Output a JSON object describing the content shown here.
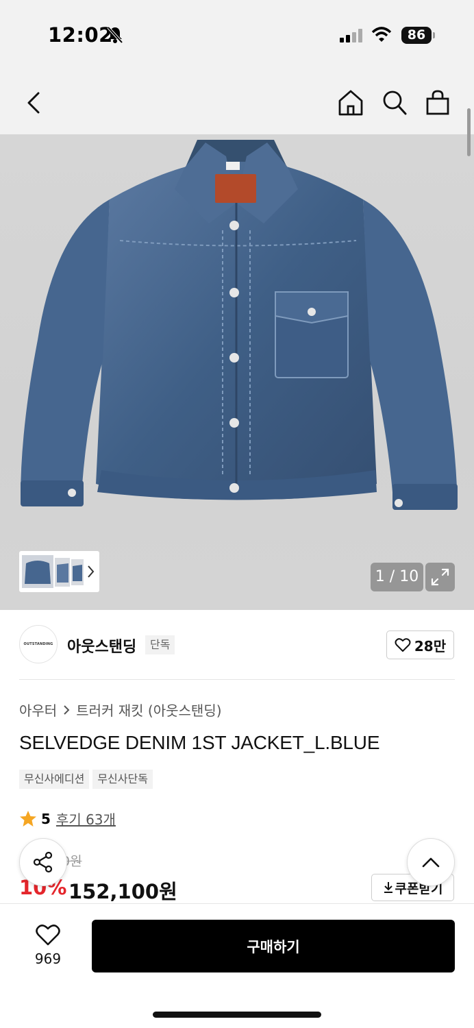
{
  "status_bar": {
    "time": "12:02",
    "battery": "86"
  },
  "nav": {
    "icons": [
      "back-arrow-icon",
      "home-icon",
      "search-icon",
      "shopping-bag-icon"
    ]
  },
  "gallery": {
    "counter": "1 / 10"
  },
  "brand": {
    "logo_text": "OUTSTANDING",
    "name": "아웃스탠딩",
    "badge": "단독",
    "likes": "28만"
  },
  "breadcrumb": {
    "category": "아우터",
    "subcategory": "트러커 재킷 (아웃스탠딩)"
  },
  "product": {
    "title": "SELVEDGE DENIM 1ST JACKET_L.BLUE",
    "tags": [
      "무신사에디션",
      "무신사단독"
    ],
    "rating": "5",
    "reviews": "후기 63개",
    "original_price": "0원",
    "discount": "10%",
    "sale_price": "152,100원",
    "coupon_label": "쿠폰받기"
  },
  "bottom_bar": {
    "wish_count": "969",
    "buy_label": "구매하기"
  },
  "colors": {
    "accent_red": "#e4262c",
    "star": "#f5a623",
    "denim": "#3f5f86"
  }
}
